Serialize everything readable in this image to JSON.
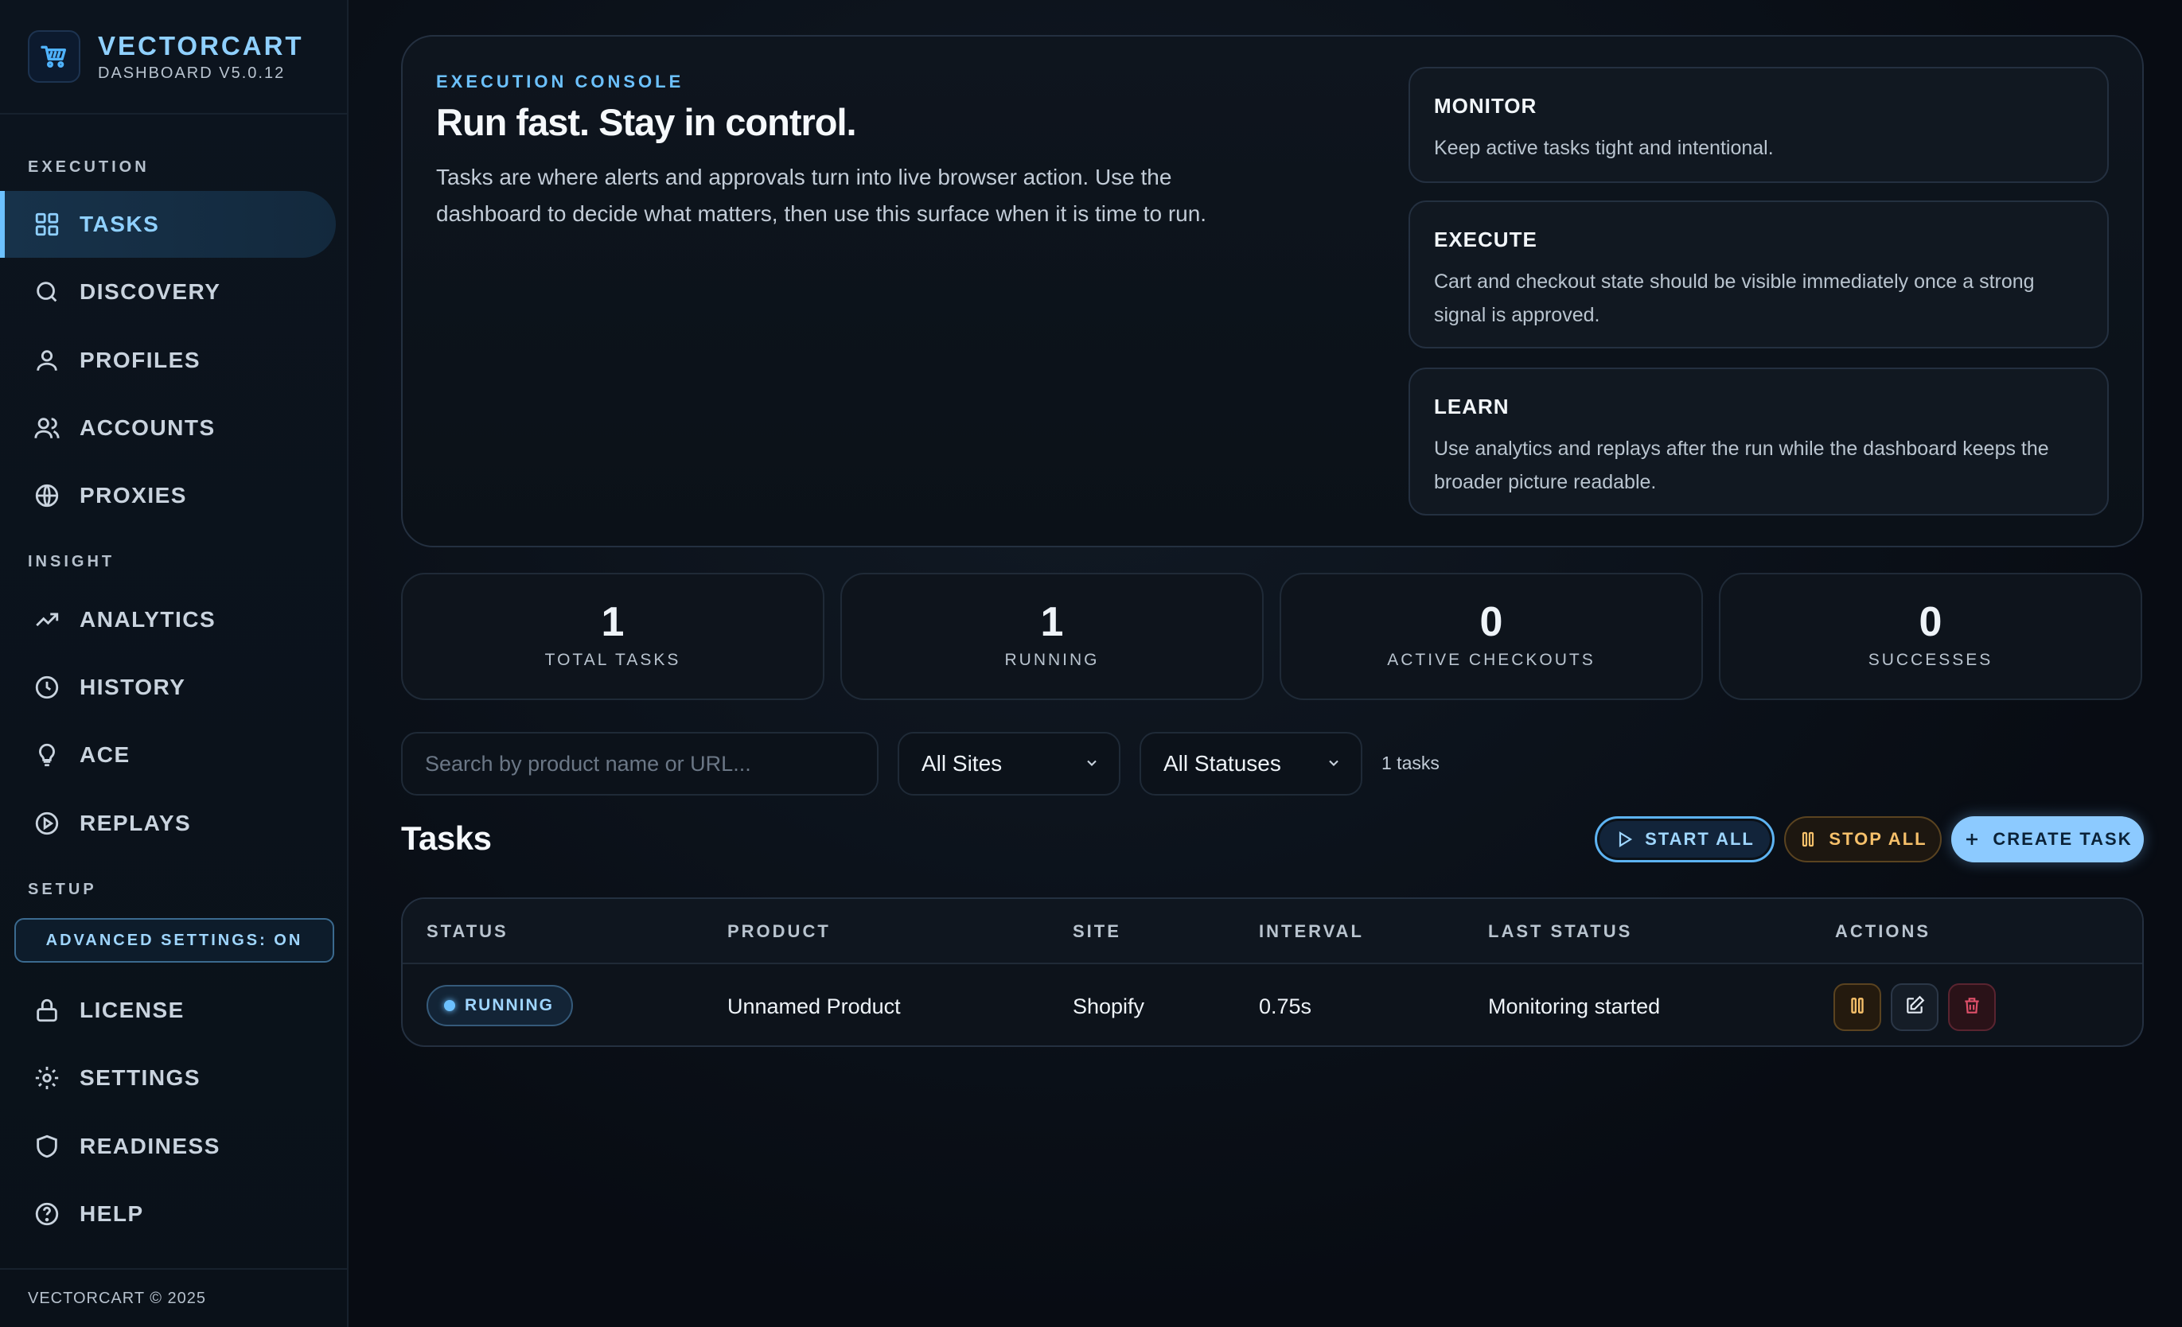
{
  "brand": {
    "name": "VECTORCART",
    "version": "DASHBOARD V5.0.12"
  },
  "sidebar": {
    "sections": {
      "execution": "EXECUTION",
      "insight": "INSIGHT",
      "setup": "SETUP"
    },
    "items": {
      "tasks": "TASKS",
      "discovery": "DISCOVERY",
      "profiles": "PROFILES",
      "accounts": "ACCOUNTS",
      "proxies": "PROXIES",
      "analytics": "ANALYTICS",
      "history": "HISTORY",
      "ace": "ACE",
      "replays": "REPLAYS",
      "license": "LICENSE",
      "settings": "SETTINGS",
      "readiness": "READINESS",
      "help": "HELP"
    },
    "active": "tasks",
    "advanced_settings": "ADVANCED SETTINGS: ON",
    "footer": "VECTORCART © 2025"
  },
  "hero": {
    "eyebrow": "EXECUTION CONSOLE",
    "title": "Run fast. Stay in control.",
    "description": "Tasks are where alerts and approvals turn into live browser action. Use the dashboard to decide what matters, then use this surface when it is time to run.",
    "cards": [
      {
        "title": "MONITOR",
        "text": "Keep active tasks tight and intentional."
      },
      {
        "title": "EXECUTE",
        "text": "Cart and checkout state should be visible immediately once a strong signal is approved."
      },
      {
        "title": "LEARN",
        "text": "Use analytics and replays after the run while the dashboard keeps the broader picture readable."
      }
    ]
  },
  "stats": [
    {
      "value": "1",
      "label": "TOTAL TASKS"
    },
    {
      "value": "1",
      "label": "RUNNING"
    },
    {
      "value": "0",
      "label": "ACTIVE CHECKOUTS"
    },
    {
      "value": "0",
      "label": "SUCCESSES"
    }
  ],
  "filters": {
    "search_placeholder": "Search by product name or URL...",
    "site_select": "All Sites",
    "status_select": "All Statuses",
    "count": "1 tasks"
  },
  "tasks": {
    "heading": "Tasks",
    "buttons": {
      "start_all": "START ALL",
      "stop_all": "STOP ALL",
      "create": "CREATE TASK"
    },
    "columns": [
      "STATUS",
      "PRODUCT",
      "SITE",
      "INTERVAL",
      "LAST STATUS",
      "ACTIONS"
    ],
    "rows": [
      {
        "status": "RUNNING",
        "product": "Unnamed Product",
        "site": "Shopify",
        "interval": "0.75s",
        "last_status": "Monitoring started"
      }
    ]
  },
  "colors": {
    "accent": "#6cc1ff",
    "warning": "#f6c06a",
    "danger": "#e0506a",
    "background": "#070b12"
  }
}
